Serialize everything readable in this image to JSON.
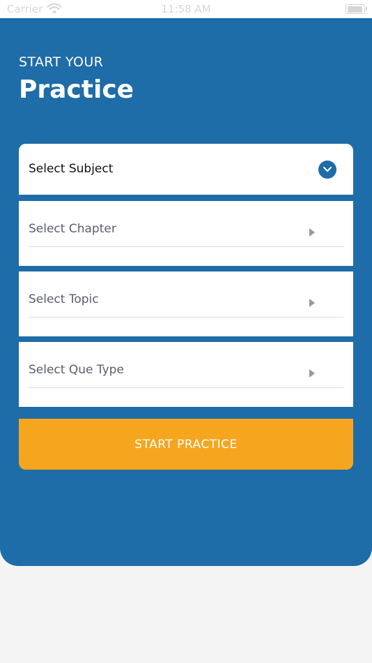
{
  "status_bar": {
    "carrier": "Carrier",
    "time": "11:58 AM",
    "icons": [
      "wifi-icon",
      "battery-icon"
    ]
  },
  "header": {
    "eyebrow": "START YOUR",
    "title": "Practice"
  },
  "form": {
    "subject": {
      "label": "Select Subject",
      "icon": "chevron-down-circle-icon"
    },
    "chapter": {
      "label": "Select Chapter",
      "icon": "caret-right-icon"
    },
    "topic": {
      "label": "Select Topic",
      "icon": "caret-right-icon"
    },
    "que_type": {
      "label": "Select Que Type",
      "icon": "caret-right-icon"
    }
  },
  "actions": {
    "start_label": "START PRACTICE"
  },
  "colors": {
    "panel_blue": "#1e6ca8",
    "button_orange": "#f6a61e",
    "background": "#f4f4f4",
    "white": "#ffffff"
  }
}
